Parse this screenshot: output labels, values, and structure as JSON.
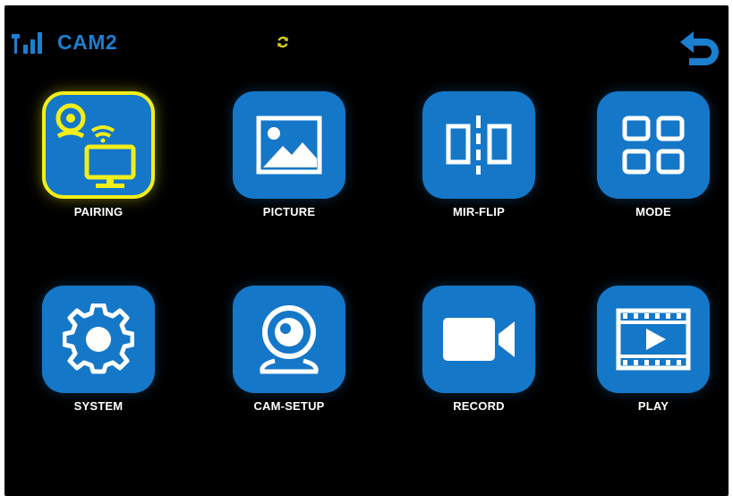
{
  "status": {
    "camera_label": "CAM2",
    "signal_icon": "signal-bars-icon",
    "sync_icon": "sync-icon",
    "back_icon": "back-arrow-icon"
  },
  "colors": {
    "accent": "#1577c8",
    "selection": "#f2ee1a",
    "background": "#000000",
    "label": "#ffffff"
  },
  "menu": {
    "selected": "PAIRING",
    "items": [
      {
        "label": "PAIRING",
        "icon": "camera-wifi-monitor-icon"
      },
      {
        "label": "PICTURE",
        "icon": "picture-icon"
      },
      {
        "label": "MIR-FLIP",
        "icon": "mirror-flip-icon"
      },
      {
        "label": "MODE",
        "icon": "grid-icon"
      },
      {
        "label": "SYSTEM",
        "icon": "gear-icon"
      },
      {
        "label": "CAM-SETUP",
        "icon": "webcam-icon"
      },
      {
        "label": "RECORD",
        "icon": "video-camera-icon"
      },
      {
        "label": "PLAY",
        "icon": "film-play-icon"
      }
    ]
  }
}
